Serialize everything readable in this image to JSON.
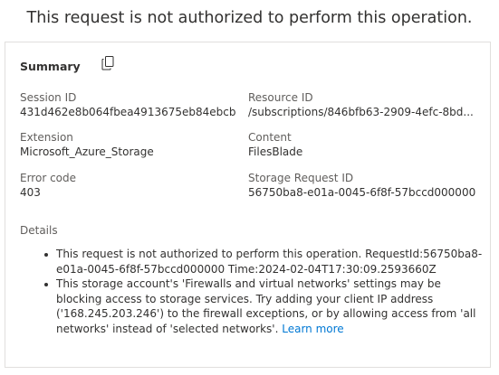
{
  "header": {
    "title": "This request is not authorized to perform this operation."
  },
  "summary": {
    "title": "Summary",
    "copy_icon": "copy-icon",
    "fields": {
      "session_id": {
        "label": "Session ID",
        "value": "431d462e8b064fbea4913675eb84ebcb"
      },
      "resource_id": {
        "label": "Resource ID",
        "value": "/subscriptions/846bfb63-2909-4efc-8bd..."
      },
      "extension": {
        "label": "Extension",
        "value": "Microsoft_Azure_Storage"
      },
      "content": {
        "label": "Content",
        "value": "FilesBlade"
      },
      "error_code": {
        "label": "Error code",
        "value": "403"
      },
      "storage_request_id": {
        "label": "Storage Request ID",
        "value": "56750ba8-e01a-0045-6f8f-57bccd000000"
      }
    }
  },
  "details": {
    "label": "Details",
    "items": [
      {
        "text": "This request is not authorized to perform this operation. RequestId:56750ba8-e01a-0045-6f8f-57bccd000000 Time:2024-02-04T17:30:09.2593660Z"
      },
      {
        "text": "This storage account's 'Firewalls and virtual networks' settings may be blocking access to storage services. Try adding your client IP address ('168.245.203.246') to the firewall exceptions, or by allowing access from 'all networks' instead of 'selected networks'.",
        "link_text": "Learn more"
      }
    ]
  },
  "colors": {
    "link": "#0078d4",
    "text": "#323130",
    "label": "#605e5c",
    "border": "#e1dfdd"
  }
}
